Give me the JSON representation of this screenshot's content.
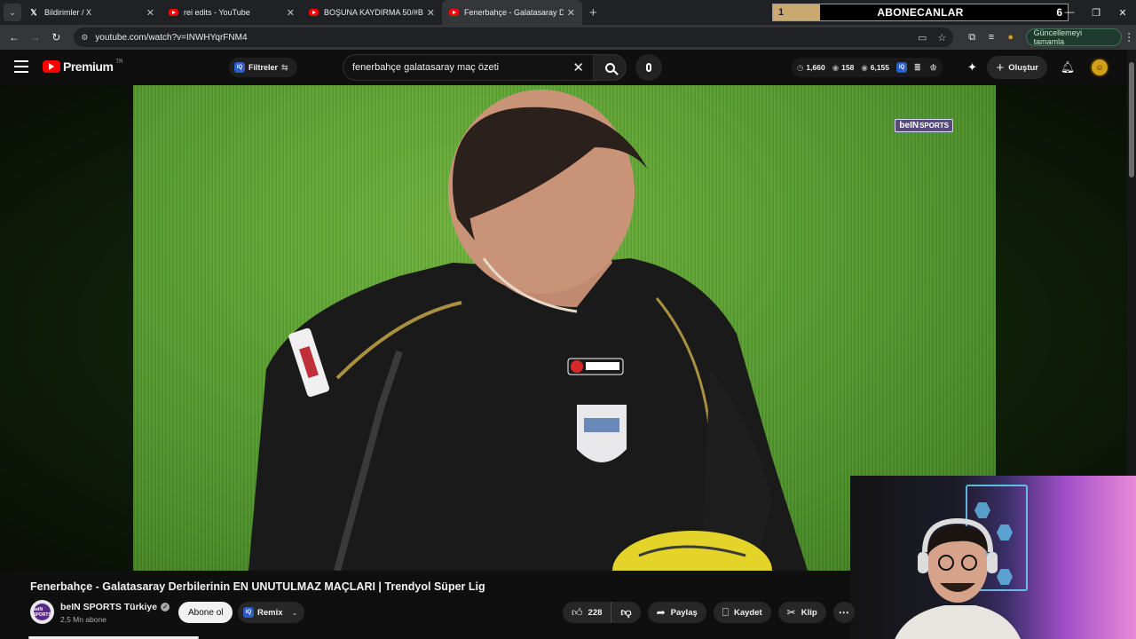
{
  "browser": {
    "tabs": [
      {
        "label": "Bildirimler / X",
        "icon": "x-icon",
        "active": false
      },
      {
        "label": "rei edits - YouTube",
        "icon": "youtube-icon",
        "active": false
      },
      {
        "label": "BOŞUNA KAYDIRMA 50/#BK50",
        "icon": "youtube-icon",
        "active": false
      },
      {
        "label": "Fenerbahçe - Galatasaray Derbi",
        "icon": "youtube-icon",
        "active": true
      }
    ],
    "new_tab_glyph": "+",
    "url": "youtube.com/watch?v=INWHYqrFNM4",
    "update_button": "Güncellemeyi tamamla"
  },
  "overlay_counter": {
    "title": "ABONECANLAR",
    "left_value": "1",
    "right_value": "6",
    "progress_fraction": 0.16,
    "accent": "#c9a971"
  },
  "youtube": {
    "brand": "Premium",
    "region": "TR",
    "filters_label": "Filtreler",
    "iq_badge": "iQ",
    "search_query": "fenerbahçe galatasaray maç özeti",
    "stats": [
      "1,660",
      "158",
      "6,155"
    ],
    "create_label": "Oluştur",
    "accent": "#ff0000"
  },
  "video": {
    "watermark_primary": "beIN",
    "watermark_secondary": "SPORTS",
    "title": "Fenerbahçe - Galatasaray Derbilerinin EN UNUTULMAZ MAÇLARI | Trendyol Süper Lig",
    "channel_name": "beIN SPORTS Türkiye",
    "channel_avatar_text": "beIN SPORTS",
    "subscribers": "2,5 Mn abone",
    "subscribe_label": "Abone ol",
    "remix_label": "Remix",
    "likes": "228",
    "share_label": "Paylaş",
    "save_label": "Kaydet",
    "clip_label": "Klip"
  }
}
